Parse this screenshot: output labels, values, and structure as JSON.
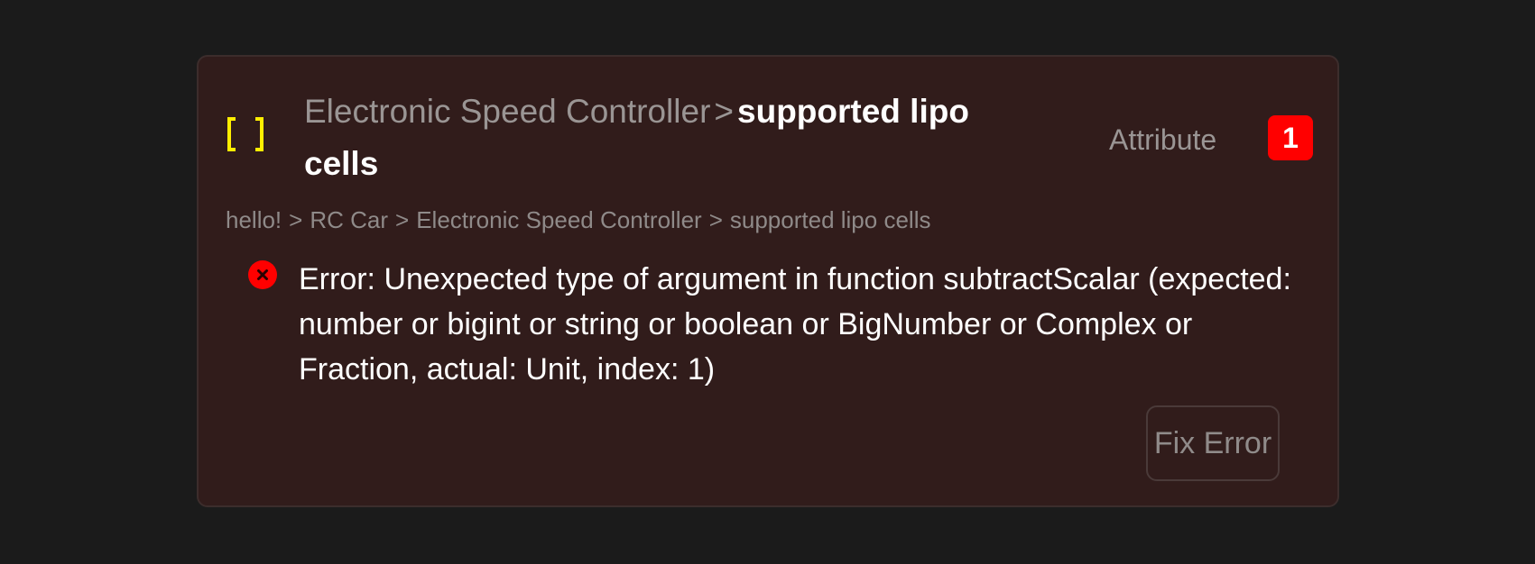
{
  "card": {
    "icon": "list-brackets-icon",
    "title_parent": "Electronic Speed Controller",
    "title_separator": ">",
    "title_current": "supported lipo cells",
    "kind_label": "Attribute",
    "error_count": "1",
    "path": [
      "hello!",
      "RC Car",
      "Electronic Speed Controller",
      "supported lipo cells"
    ],
    "path_separator": ">",
    "error": {
      "icon": "error-x-circle-icon",
      "message": "Error: Unexpected type of argument in function subtractScalar (expected: number or bigint or string or boolean or BigNumber or Complex or Fraction, actual: Unit, index: 1)"
    },
    "fix_button_label": "Fix Error"
  },
  "colors": {
    "background": "#1b1b1b",
    "card": "#311c1b",
    "icon_yellow": "#ffee00",
    "badge_red": "#ff0000",
    "muted_text": "#9a9594"
  }
}
